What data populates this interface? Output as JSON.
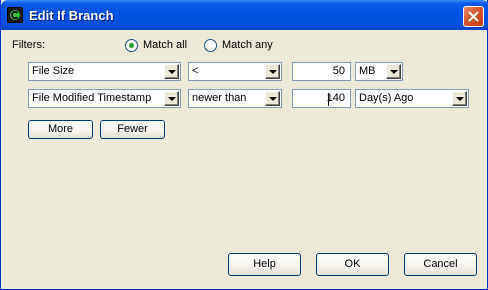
{
  "window": {
    "title": "Edit If Branch"
  },
  "filters": {
    "label": "Filters:",
    "match_all_label": "Match all",
    "match_any_label": "Match any",
    "selected_match": "all"
  },
  "rows": [
    {
      "field": "File Size",
      "operator": "<",
      "value": "50",
      "unit": "MB"
    },
    {
      "field": "File Modified Timestamp",
      "operator": "newer than",
      "value": "140",
      "unit": "Day(s) Ago"
    }
  ],
  "actions": {
    "more": "More",
    "fewer": "Fewer"
  },
  "footer": {
    "help": "Help",
    "ok": "OK",
    "cancel": "Cancel"
  },
  "icons": {
    "app": "app-c-icon",
    "close": "close-icon",
    "dropdown": "chevron-down-icon"
  },
  "colors": {
    "titlebar": "#0054e3",
    "dialog_bg": "#ece9d8",
    "close_button": "#d6542c",
    "radio_dot": "#21a121"
  }
}
